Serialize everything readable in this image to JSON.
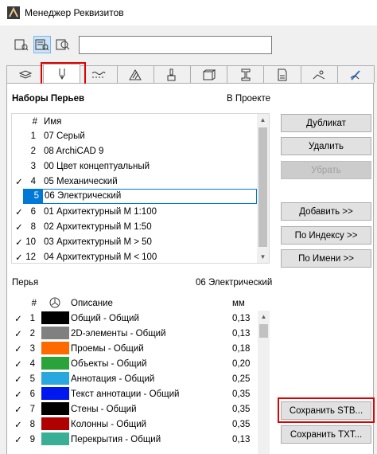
{
  "window": {
    "title": "Менеджер Реквизитов"
  },
  "view_buttons": [
    {
      "name": "view-list-icon"
    },
    {
      "name": "view-list-detail-icon",
      "selected": true
    },
    {
      "name": "view-find-icon"
    }
  ],
  "search": {
    "value": "",
    "placeholder": ""
  },
  "tabs": [
    {
      "icon": "layers-icon"
    },
    {
      "icon": "pen-icon",
      "active": true
    },
    {
      "icon": "line-type-icon"
    },
    {
      "icon": "fill-icon"
    },
    {
      "icon": "paint-brush-icon"
    },
    {
      "icon": "composite-icon"
    },
    {
      "icon": "profile-icon"
    },
    {
      "icon": "beam-icon"
    },
    {
      "icon": "zone-icon"
    },
    {
      "icon": "surface-icon"
    }
  ],
  "pen_sets": {
    "heading": "Наборы Перьев",
    "in_project_label": "В Проекте",
    "col_num": "#",
    "col_name": "Имя",
    "rows": [
      {
        "check": "",
        "num": "1",
        "name": "07 Серый"
      },
      {
        "check": "",
        "num": "2",
        "name": "08 ArchiCAD 9"
      },
      {
        "check": "",
        "num": "3",
        "name": "00 Цвет концептуальный"
      },
      {
        "check": "✓",
        "num": "4",
        "name": "05 Механический"
      },
      {
        "check": "",
        "num": "5",
        "name": "06 Электрический",
        "selected": true
      },
      {
        "check": "✓",
        "num": "6",
        "name": "01 Архитектурный М 1:100"
      },
      {
        "check": "✓",
        "num": "8",
        "name": "02 Архитектурный М 1:50"
      },
      {
        "check": "✓",
        "num": "10",
        "name": "03 Архитектурный М > 50"
      },
      {
        "check": "✓",
        "num": "12",
        "name": "04 Архитектурный М < 100"
      }
    ]
  },
  "buttons": {
    "duplicate": "Дубликат",
    "delete": "Удалить",
    "remove": "Убрать",
    "add": "Добавить >>",
    "by_index": "По Индексу >>",
    "by_name": "По Имени >>",
    "save_stb": "Сохранить STB...",
    "save_txt": "Сохранить TXT..."
  },
  "pens": {
    "heading": "Перья",
    "set_name": "06 Электрический",
    "col_num": "#",
    "col_desc": "Описание",
    "col_mm": "мм",
    "rows": [
      {
        "check": "✓",
        "num": "1",
        "color": "#000000",
        "desc": "Общий - Общий",
        "mm": "0,13"
      },
      {
        "check": "✓",
        "num": "2",
        "color": "#808080",
        "desc": "2D-элементы - Общий",
        "mm": "0,13"
      },
      {
        "check": "✓",
        "num": "3",
        "color": "#ff6a00",
        "desc": "Проемы - Общий",
        "mm": "0,18"
      },
      {
        "check": "✓",
        "num": "4",
        "color": "#2aa33a",
        "desc": "Объекты - Общий",
        "mm": "0,20"
      },
      {
        "check": "✓",
        "num": "5",
        "color": "#29a8e0",
        "desc": "Аннотация - Общий",
        "mm": "0,25"
      },
      {
        "check": "✓",
        "num": "6",
        "color": "#0018f0",
        "desc": "Текст аннотации - Общий",
        "mm": "0,35"
      },
      {
        "check": "✓",
        "num": "7",
        "color": "#000000",
        "desc": "Стены - Общий",
        "mm": "0,35"
      },
      {
        "check": "✓",
        "num": "8",
        "color": "#b00000",
        "desc": "Колонны - Общий",
        "mm": "0,35"
      },
      {
        "check": "✓",
        "num": "9",
        "color": "#3aaf96",
        "desc": "Перекрытия - Общий",
        "mm": "0,13"
      }
    ]
  }
}
